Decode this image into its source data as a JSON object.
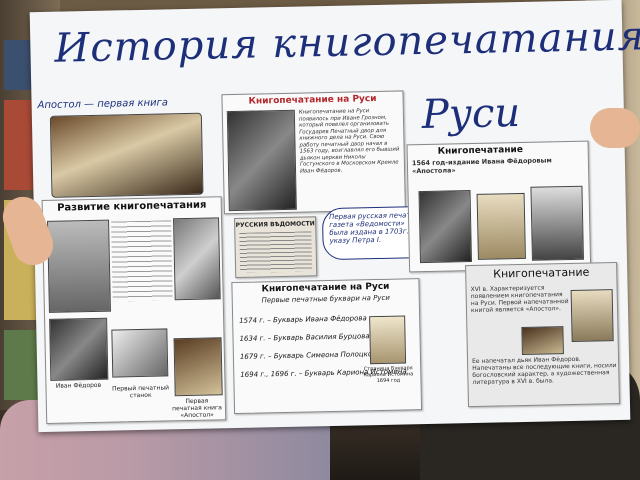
{
  "poster": {
    "title_line1": "История книгопечатания на",
    "title_line2": "Руси",
    "handwritten_caption": "Апостол — первая книга",
    "handwritten_note": "Первая русская печатная газета «Ведомости» была издана в 1703г. по указу Петра I.",
    "cards": {
      "rusi": {
        "heading": "Книгопечатание на Руси",
        "text": "Книгопечатание на Руси появилось при Иване Грозном, который повелел организовать Государев Печатный двор для книжного дела на Руси. Свою работу печатный двор начал в 1563 году, возглавлял его бывший дьякон церкви Николы Гостунского в Московском Кремле Иван Фёдоров."
      },
      "razvitie": {
        "heading": "Развитие книгопечатания",
        "caption_fedorov": "Иван Фёдоров",
        "caption_press": "Первый печатный станок",
        "caption_book": "Первая печатная книга «Апостол»"
      },
      "knigopechatanie": {
        "heading": "Книгопечатание",
        "subheading": "1564 год-издание Ивана Фёдоровым «Апостола»"
      },
      "newspaper": {
        "label": "РУССКИЯ ВѢДОМОСТИ"
      },
      "bukvari": {
        "heading": "Книгопечатание на Руси",
        "subheading": "Первые печатные буквари на Руси",
        "lines": [
          "1574 г. – Букварь Ивана Фёдорова",
          "1634 г. – Букварь Василия Бурцова",
          "1679 г. – Букварь Симеона Полоцкого",
          "1694 г., 1696 г. – Букварь Кариона Истомина"
        ],
        "caption": "Страница Букваря Кариона Истомина 1694 год"
      },
      "right": {
        "heading": "Книгопечатание",
        "text1": "XVI в. Характеризуется появлением книгопечатания на Руси. Первой напечатанной книгой является «Апостол».",
        "text2": "Ее напечатал дьяк Иван Фёдоров. Напечатаны все последующие книги, носили богословский характер, а художественная литература в XVI в. была."
      }
    }
  },
  "colors": {
    "marker": "#1e2f7a",
    "card_header_red": "#b3262a"
  }
}
